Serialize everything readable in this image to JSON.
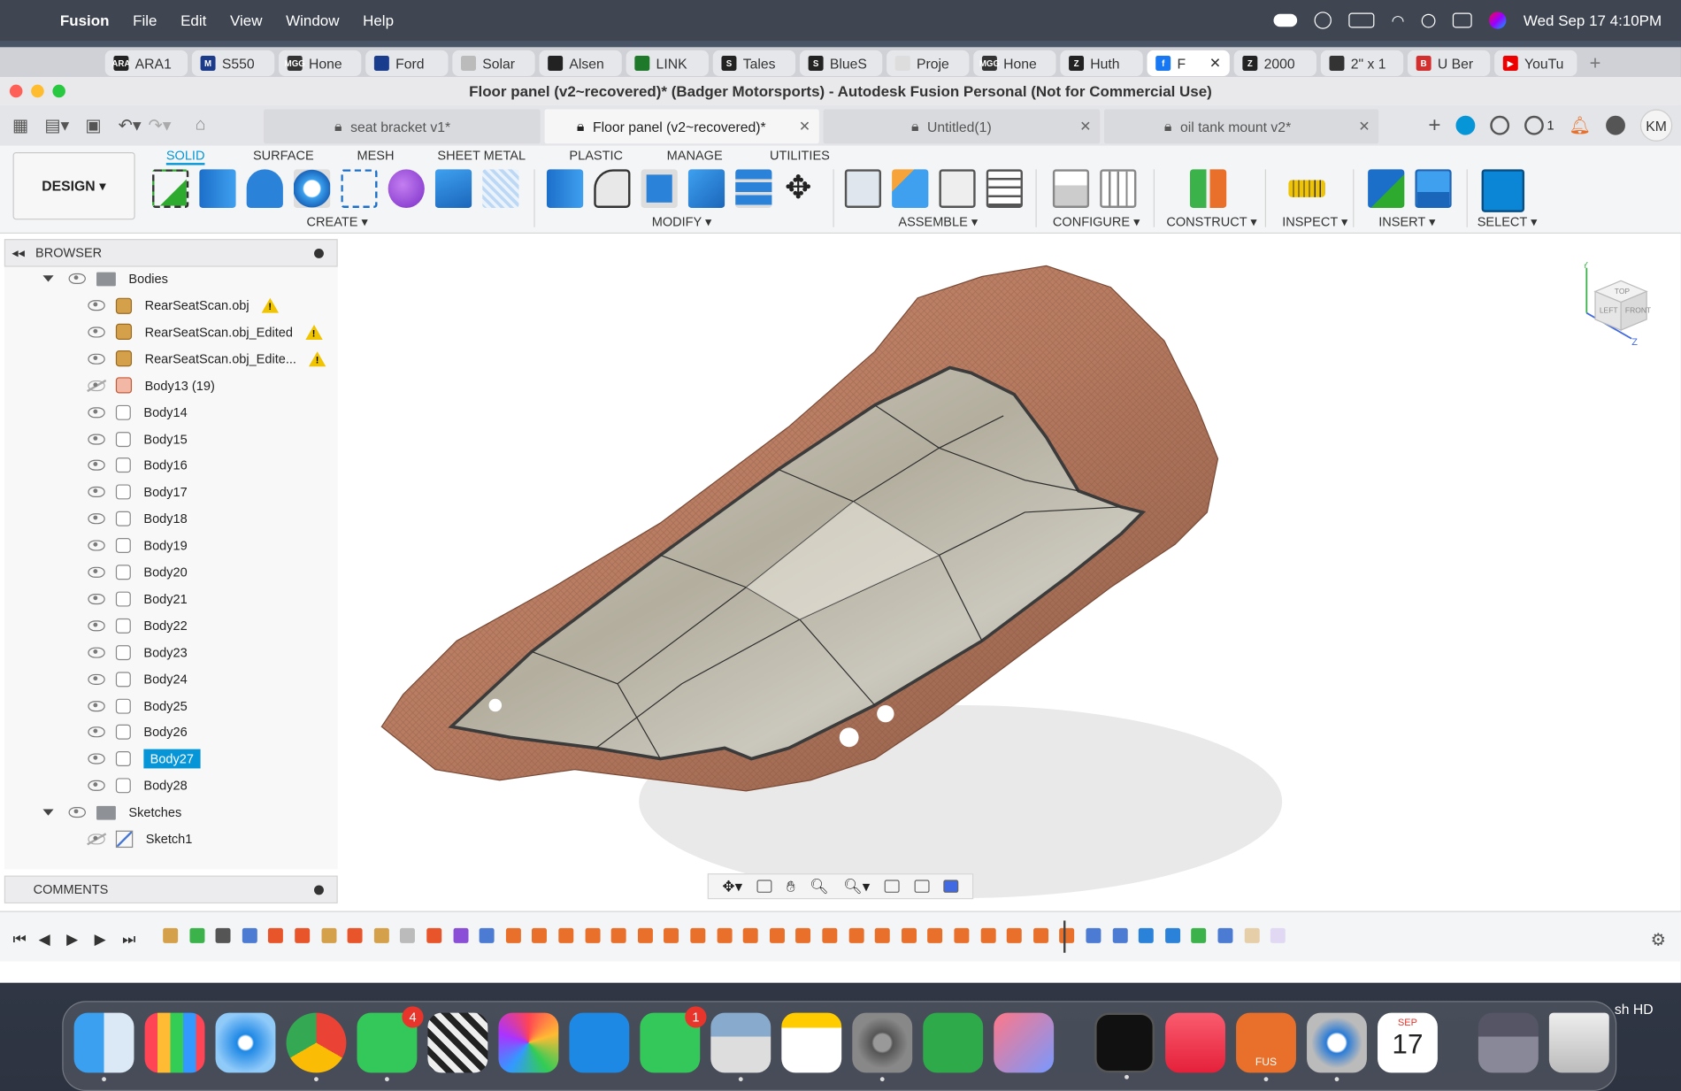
{
  "menubar": {
    "app_name": "Fusion",
    "menus": [
      "File",
      "Edit",
      "View",
      "Window",
      "Help"
    ],
    "clock": "Wed Sep 17  4:10PM"
  },
  "browser_tabs": [
    {
      "label": "ARA1",
      "fav": "ARA",
      "color": "#222"
    },
    {
      "label": "S550",
      "fav": "M",
      "color": "#1b3a8a"
    },
    {
      "label": "Hone",
      "fav": "MGG",
      "color": "#333"
    },
    {
      "label": "Ford",
      "fav": "",
      "color": "#1a3c8c"
    },
    {
      "label": "Solar",
      "fav": "",
      "color": "#bbb"
    },
    {
      "label": "Alsen",
      "fav": "",
      "color": "#222"
    },
    {
      "label": "LINK",
      "fav": "",
      "color": "#1e7a2a"
    },
    {
      "label": "Tales",
      "fav": "S",
      "color": "#222"
    },
    {
      "label": "BlueS",
      "fav": "S",
      "color": "#222"
    },
    {
      "label": "Proje",
      "fav": "",
      "color": "#ddd"
    },
    {
      "label": "Hone",
      "fav": "MGG",
      "color": "#333"
    },
    {
      "label": "Huth",
      "fav": "Z",
      "color": "#222"
    },
    {
      "label": "F",
      "fav": "f",
      "color": "#1877f2",
      "active": true
    },
    {
      "label": "2000",
      "fav": "Z",
      "color": "#222"
    },
    {
      "label": "2\" x 1",
      "fav": "",
      "color": "#333"
    },
    {
      "label": "U Ber",
      "fav": "B",
      "color": "#d32f2f"
    },
    {
      "label": "YouTu",
      "fav": "▶",
      "color": "#e00"
    }
  ],
  "window": {
    "title": "Floor panel (v2~recovered)* (Badger Motorsports) - Autodesk Fusion Personal (Not for Commercial Use)"
  },
  "doc_tabs": [
    {
      "label": "seat bracket v1*"
    },
    {
      "label": "Floor panel (v2~recovered)*",
      "active": true
    },
    {
      "label": "Untitled(1)"
    },
    {
      "label": "oil tank mount v2*"
    }
  ],
  "doc_right": {
    "jobs_count": "1",
    "user_initials": "KM"
  },
  "ribbon": {
    "workspace": "DESIGN",
    "tabs": [
      "SOLID",
      "SURFACE",
      "MESH",
      "SHEET METAL",
      "PLASTIC",
      "MANAGE",
      "UTILITIES"
    ],
    "groups": {
      "create": "CREATE",
      "modify": "MODIFY",
      "assemble": "ASSEMBLE",
      "configure": "CONFIGURE",
      "construct": "CONSTRUCT",
      "inspect": "INSPECT",
      "insert": "INSERT",
      "select": "SELECT"
    }
  },
  "browser": {
    "title": "BROWSER",
    "bodies_folder": "Bodies",
    "items": [
      {
        "label": "RearSeatScan.obj",
        "type": "mesh",
        "warn": true
      },
      {
        "label": "RearSeatScan.obj_Edited",
        "type": "mesh",
        "warn": true
      },
      {
        "label": "RearSeatScan.obj_Edite...",
        "type": "mesh",
        "warn": true
      },
      {
        "label": "Body13 (19)",
        "type": "comp",
        "hidden": true
      },
      {
        "label": "Body14",
        "type": "body"
      },
      {
        "label": "Body15",
        "type": "body"
      },
      {
        "label": "Body16",
        "type": "body"
      },
      {
        "label": "Body17",
        "type": "body"
      },
      {
        "label": "Body18",
        "type": "body"
      },
      {
        "label": "Body19",
        "type": "body"
      },
      {
        "label": "Body20",
        "type": "body"
      },
      {
        "label": "Body21",
        "type": "body"
      },
      {
        "label": "Body22",
        "type": "body"
      },
      {
        "label": "Body23",
        "type": "body"
      },
      {
        "label": "Body24",
        "type": "body"
      },
      {
        "label": "Body25",
        "type": "body"
      },
      {
        "label": "Body26",
        "type": "body"
      },
      {
        "label": "Body27",
        "type": "body",
        "selected": true
      },
      {
        "label": "Body28",
        "type": "body"
      }
    ],
    "sketches_folder": "Sketches",
    "sketch_items": [
      {
        "label": "Sketch1",
        "hidden": true
      }
    ]
  },
  "comments": {
    "title": "COMMENTS"
  },
  "viewcube": {
    "top": "TOP",
    "left": "LEFT",
    "front": "FRONT",
    "z": "Z",
    "y": "Y"
  },
  "dock": {
    "messages_badge": "4",
    "facetime_badge": "1",
    "calendar_month": "SEP",
    "calendar_day": "17",
    "fusion_label": "FUS"
  },
  "overflow_text": "sh HD"
}
